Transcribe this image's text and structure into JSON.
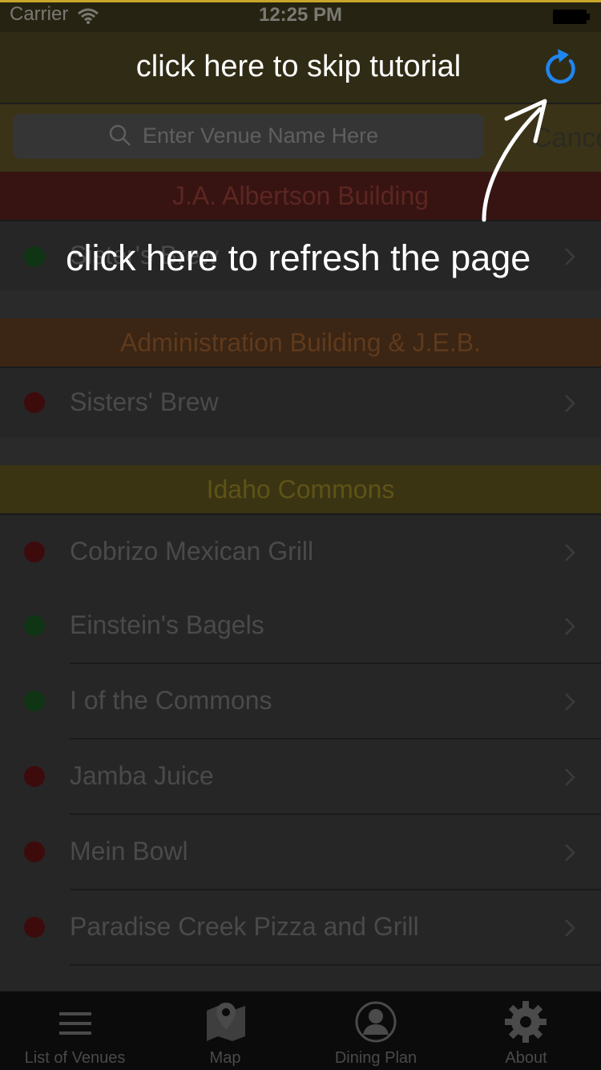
{
  "status_bar": {
    "carrier": "Carrier",
    "time": "12:25 PM",
    "icons": [
      "wifi-icon",
      "battery-icon"
    ]
  },
  "search": {
    "placeholder": "Enter Venue Name Here",
    "cancel_label": "Cancel",
    "icon": "search-icon"
  },
  "sections": [
    {
      "title": "J.A. Albertson Building",
      "color": "#5c2621",
      "venues": [
        {
          "name": "Sister's Brew",
          "status": "open",
          "status_color": "#0f3514"
        }
      ]
    },
    {
      "title": "Administration Building & J.E.B.",
      "color": "#5f3a1c",
      "venues": [
        {
          "name": "Sisters' Brew",
          "status": "closed",
          "status_color": "#3d0b0c"
        }
      ]
    },
    {
      "title": "Idaho Commons",
      "color": "#5e5317",
      "venues": [
        {
          "name": "Cobrizo Mexican Grill",
          "status": "closed",
          "status_color": "#3d0b0c"
        },
        {
          "name": "Einstein's Bagels",
          "status": "open",
          "status_color": "#0f3514"
        },
        {
          "name": "I of the Commons",
          "status": "open",
          "status_color": "#0f3514"
        },
        {
          "name": "Jamba Juice",
          "status": "closed",
          "status_color": "#3d0b0c"
        },
        {
          "name": "Mein Bowl",
          "status": "closed",
          "status_color": "#3d0b0c"
        },
        {
          "name": "Paradise Creek Pizza and Grill",
          "status": "closed",
          "status_color": "#3d0b0c"
        }
      ]
    }
  ],
  "tutorial": {
    "skip_text": "click here to skip tutorial",
    "refresh_text": "click here to refresh the page",
    "refresh_icon": "refresh-icon",
    "accent_color": "#1e86f0"
  },
  "tab_bar": {
    "tabs": [
      {
        "label": "List of Venues",
        "icon": "list-icon"
      },
      {
        "label": "Map",
        "icon": "map-icon"
      },
      {
        "label": "Dining Plan",
        "icon": "person-icon"
      },
      {
        "label": "About",
        "icon": "gear-icon"
      }
    ]
  }
}
